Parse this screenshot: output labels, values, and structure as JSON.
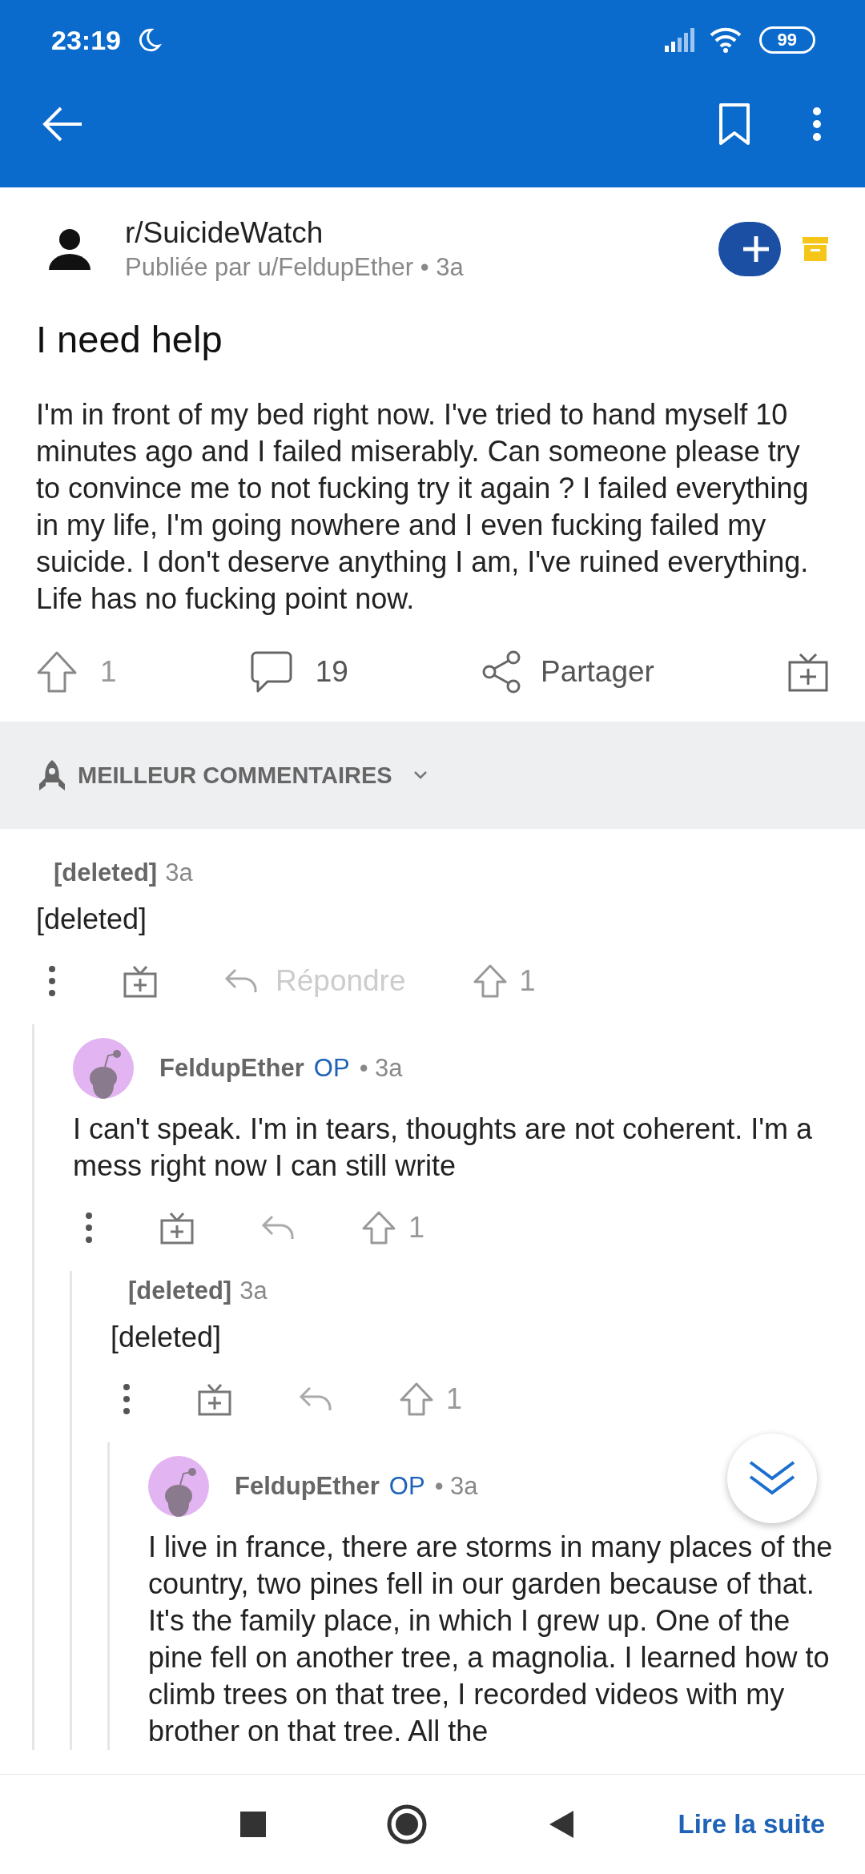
{
  "status_bar": {
    "time": "23:19",
    "battery": "99"
  },
  "post": {
    "subreddit": "r/SuicideWatch",
    "byline": "Publiée par u/FeldupEther • 3a",
    "title": "I need help",
    "body": "I'm in front of my bed right now. I've tried to hand myself 10 minutes ago and I failed miserably. Can someone please try to convince me to not fucking try it again ? I failed everything in my life, I'm going nowhere and I even fucking failed my suicide. I don't deserve anything I am, I've ruined everything. Life has no fucking point now.",
    "upvotes": "1",
    "comments": "19",
    "share_label": "Partager"
  },
  "sort": {
    "label": "MEILLEUR COMMENTAIRES"
  },
  "comments": [
    {
      "kind": "deleted",
      "author": "[deleted]",
      "age": "3a",
      "body": "[deleted]",
      "reply_label": "Répondre",
      "upvotes": "1",
      "children": [
        {
          "kind": "user",
          "author": "FeldupEther",
          "badge": "OP",
          "age": "• 3a",
          "body": "I can't speak. I'm in tears, thoughts are not coherent. I'm a mess right now I can still write",
          "upvotes": "1",
          "children": [
            {
              "kind": "deleted",
              "author": "[deleted]",
              "age": "3a",
              "body": "[deleted]",
              "upvotes": "1",
              "children": [
                {
                  "kind": "user",
                  "author": "FeldupEther",
                  "badge": "OP",
                  "age": "• 3a",
                  "body": "I live in france, there are storms in many places of the country, two pines fell in our garden because of that. It's the family place, in which I grew up. One of the pine fell on another tree, a magnolia. I learned how to climb trees on that tree, I recorded videos with my brother on that tree. All the"
                }
              ]
            }
          ]
        }
      ]
    }
  ],
  "nav": {
    "read_more": "Lire la suite"
  }
}
